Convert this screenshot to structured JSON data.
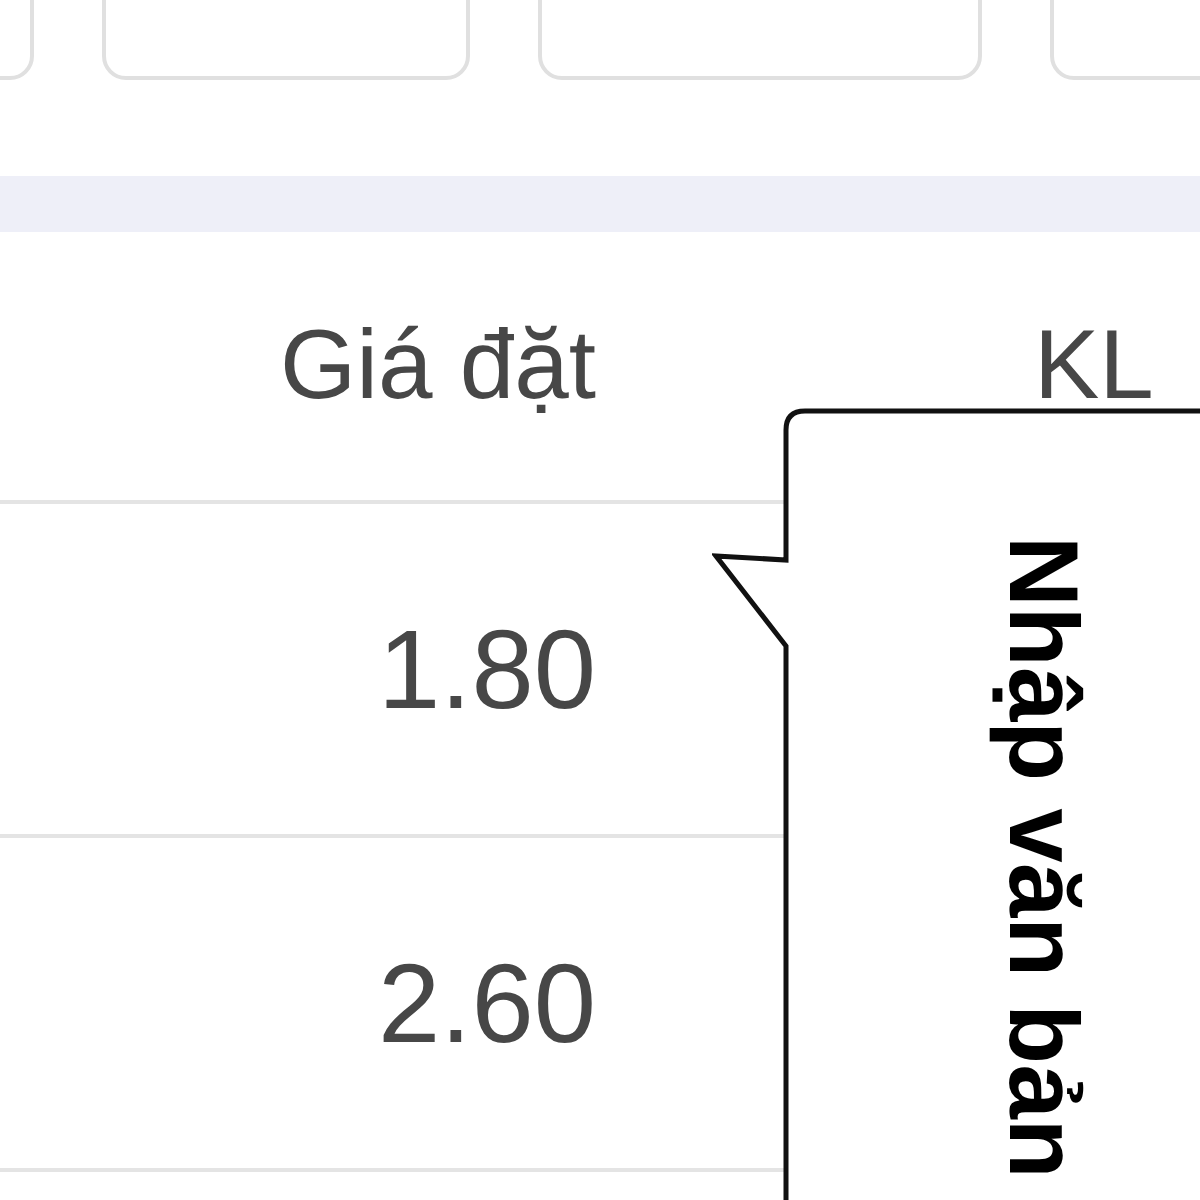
{
  "filter_buttons": [
    {
      "selected": false
    },
    {
      "selected": false
    },
    {
      "selected": false
    },
    {
      "selected": false
    }
  ],
  "table": {
    "columns": [
      "Giá đặt",
      "KL"
    ],
    "rows": [
      [
        "1.80"
      ],
      [
        "2.60"
      ]
    ]
  },
  "tooltip": {
    "text": "Nhập văn bản"
  }
}
